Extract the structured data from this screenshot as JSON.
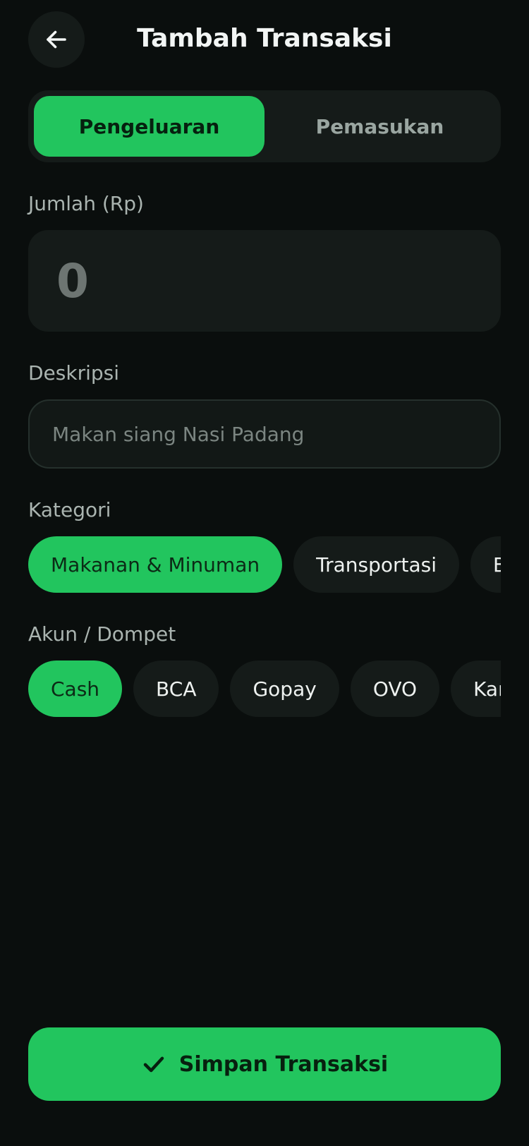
{
  "header": {
    "title": "Tambah Transaksi",
    "back_icon": "arrow-left-icon"
  },
  "type_toggle": {
    "options": [
      "Pengeluaran",
      "Pemasukan"
    ],
    "selected": "Pengeluaran"
  },
  "amount": {
    "label": "Jumlah (Rp)",
    "value": "0"
  },
  "description": {
    "label": "Deskripsi",
    "placeholder": "Makan siang Nasi Padang",
    "value": ""
  },
  "category": {
    "label": "Kategori",
    "options": [
      "Makanan & Minuman",
      "Transportasi",
      "Be"
    ],
    "selected": "Makanan & Minuman"
  },
  "account": {
    "label": "Akun / Dompet",
    "options": [
      "Cash",
      "BCA",
      "Gopay",
      "OVO",
      "Kart"
    ],
    "selected": "Cash"
  },
  "save_button": {
    "label": "Simpan Transaksi",
    "icon": "check-icon"
  },
  "colors": {
    "background": "#0a0e0d",
    "surface": "#151b19",
    "accent": "#22c55e",
    "muted_text": "#aab4b0"
  }
}
